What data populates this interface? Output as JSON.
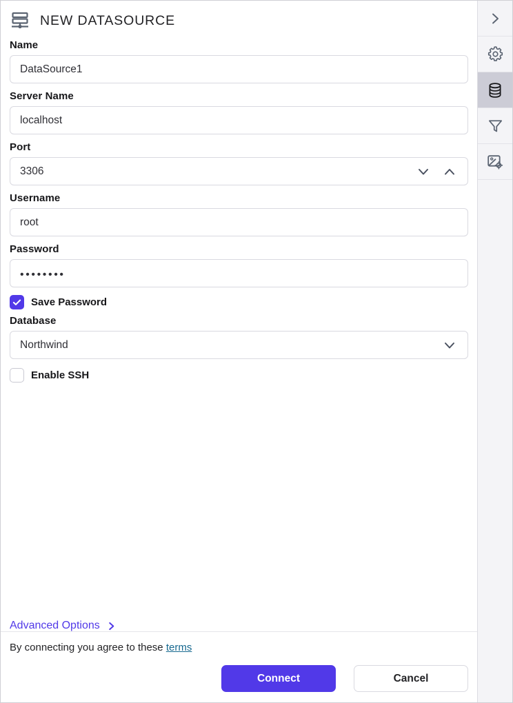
{
  "header": {
    "title": "NEW DATASOURCE",
    "icon": "datasource-stack-icon"
  },
  "form": {
    "fields": [
      {
        "label": "Name",
        "value": "DataSource1",
        "type": "text"
      },
      {
        "label": "Server Name",
        "value": "localhost",
        "type": "text"
      },
      {
        "label": "Port",
        "value": "3306",
        "type": "spinner"
      },
      {
        "label": "Username",
        "value": "root",
        "type": "text"
      },
      {
        "label": "Password",
        "value": "••••••••",
        "type": "password"
      }
    ],
    "save_password": {
      "label": "Save Password",
      "checked": true
    },
    "database": {
      "label": "Database",
      "value": "Northwind",
      "type": "select"
    },
    "enable_ssh": {
      "label": "Enable SSH",
      "checked": false
    }
  },
  "advanced_options": {
    "label": "Advanced Options",
    "icon": "chevron-right-icon"
  },
  "footer": {
    "terms_prefix": "By connecting you agree to these",
    "terms_link": "terms",
    "connect_label": "Connect",
    "cancel_label": "Cancel"
  },
  "rail": {
    "items": [
      {
        "icon": "chevron-right-icon",
        "name": "expand",
        "active": false
      },
      {
        "icon": "gear-icon",
        "name": "settings",
        "active": false
      },
      {
        "icon": "database-icon",
        "name": "datasource",
        "active": true
      },
      {
        "icon": "funnel-icon",
        "name": "filter",
        "active": false
      },
      {
        "icon": "image-settings-icon",
        "name": "image-settings",
        "active": false
      }
    ]
  },
  "colors": {
    "accent": "#5139e8",
    "link": "#16688f",
    "rail_active": "#ccccd6",
    "border": "#d9d9e0"
  }
}
